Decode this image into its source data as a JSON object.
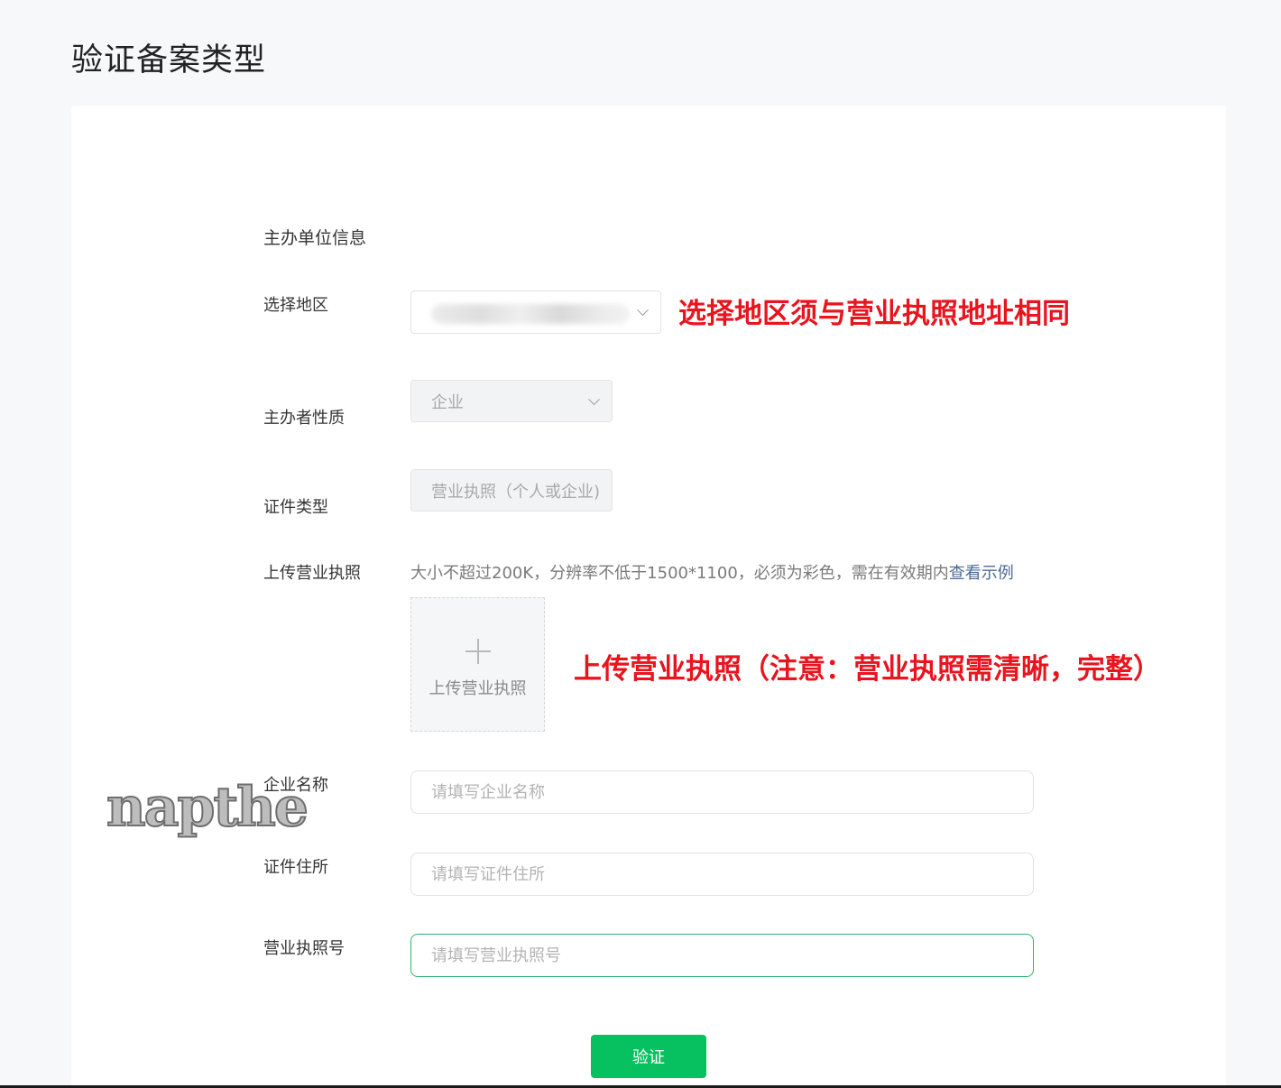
{
  "page": {
    "title": "验证备案类型"
  },
  "section": {
    "title": "主办单位信息"
  },
  "fields": {
    "region": {
      "label": "选择地区",
      "annotation": "选择地区须与营业执照地址相同"
    },
    "nature": {
      "label": "主办者性质",
      "value": "企业"
    },
    "cert_type": {
      "label": "证件类型",
      "value": "营业执照（个人或企业)"
    },
    "upload": {
      "label": "上传营业执照",
      "hint": "大小不超过200K，分辨率不低于1500*1100，必须为彩色，需在有效期内",
      "example_link": "查看示例",
      "button_text": "上传营业执照",
      "annotation": "上传营业执照（注意：营业执照需清晰，完整）"
    },
    "company_name": {
      "label": "企业名称",
      "placeholder": "请填写企业名称"
    },
    "address": {
      "label": "证件住所",
      "placeholder": "请填写证件住所"
    },
    "license_no": {
      "label": "营业执照号",
      "placeholder": "请填写营业执照号"
    }
  },
  "watermark": "napthe",
  "submit": {
    "label": "验证"
  },
  "colors": {
    "primary": "#07c160",
    "annotation": "#e8141e",
    "link": "#4d6a92",
    "focus_border": "#2fb36b"
  },
  "icons": {
    "select_arrow": "chevron-down-icon",
    "upload": "plus-icon"
  }
}
